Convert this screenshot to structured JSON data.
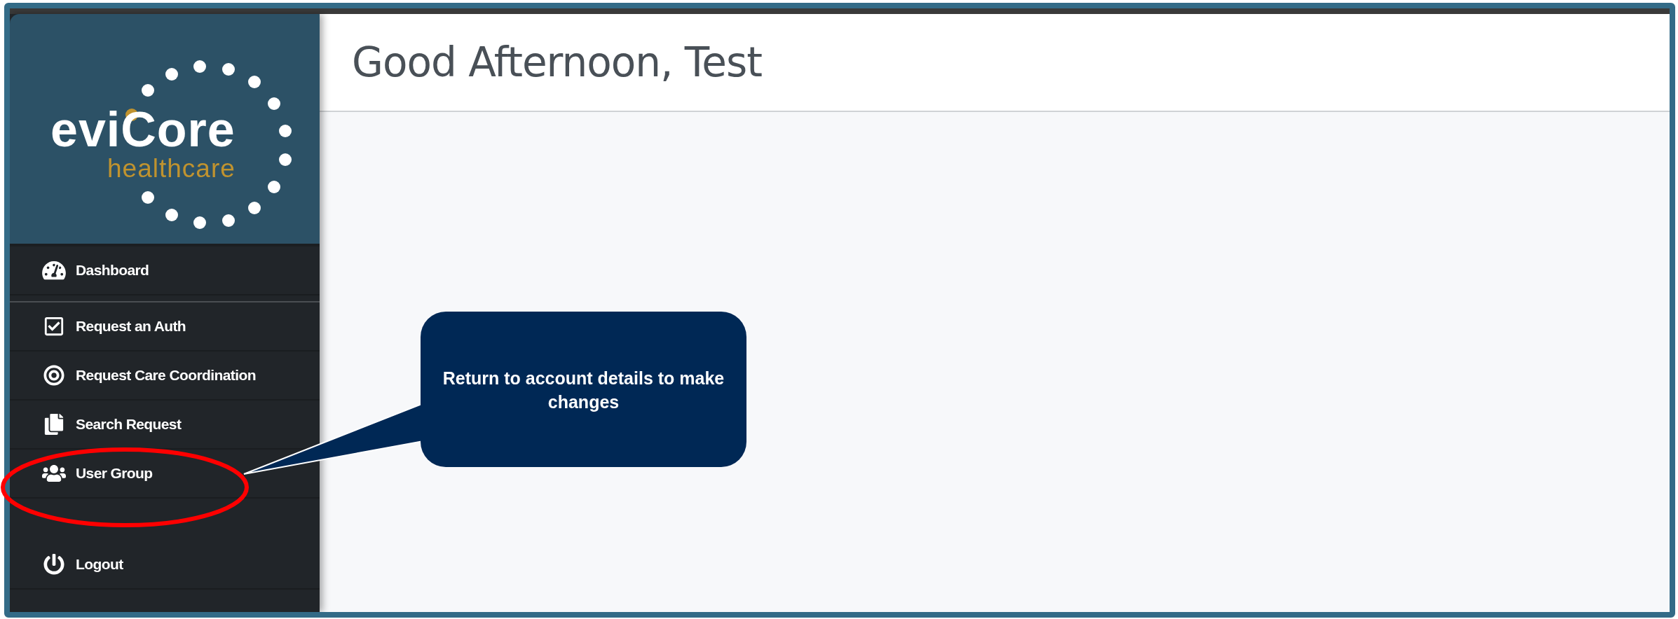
{
  "logo": {
    "name": "eviCore",
    "tagline": "healthcare"
  },
  "menu_groups": [
    {
      "items": [
        {
          "label": "Dashboard",
          "kind": "dashboard"
        }
      ]
    },
    {
      "items": [
        {
          "label": "Request an Auth",
          "kind": "auth"
        },
        {
          "label": "Request Care Coordination",
          "kind": "care"
        },
        {
          "label": "Search Request",
          "kind": "search"
        },
        {
          "label": "User Group",
          "kind": "users"
        }
      ]
    },
    {
      "items": [
        {
          "label": "Logout",
          "kind": "logout"
        }
      ]
    }
  ],
  "header": {
    "title": "Good Afternoon, Test"
  },
  "annotation": {
    "text": "Return to account details to make changes"
  }
}
